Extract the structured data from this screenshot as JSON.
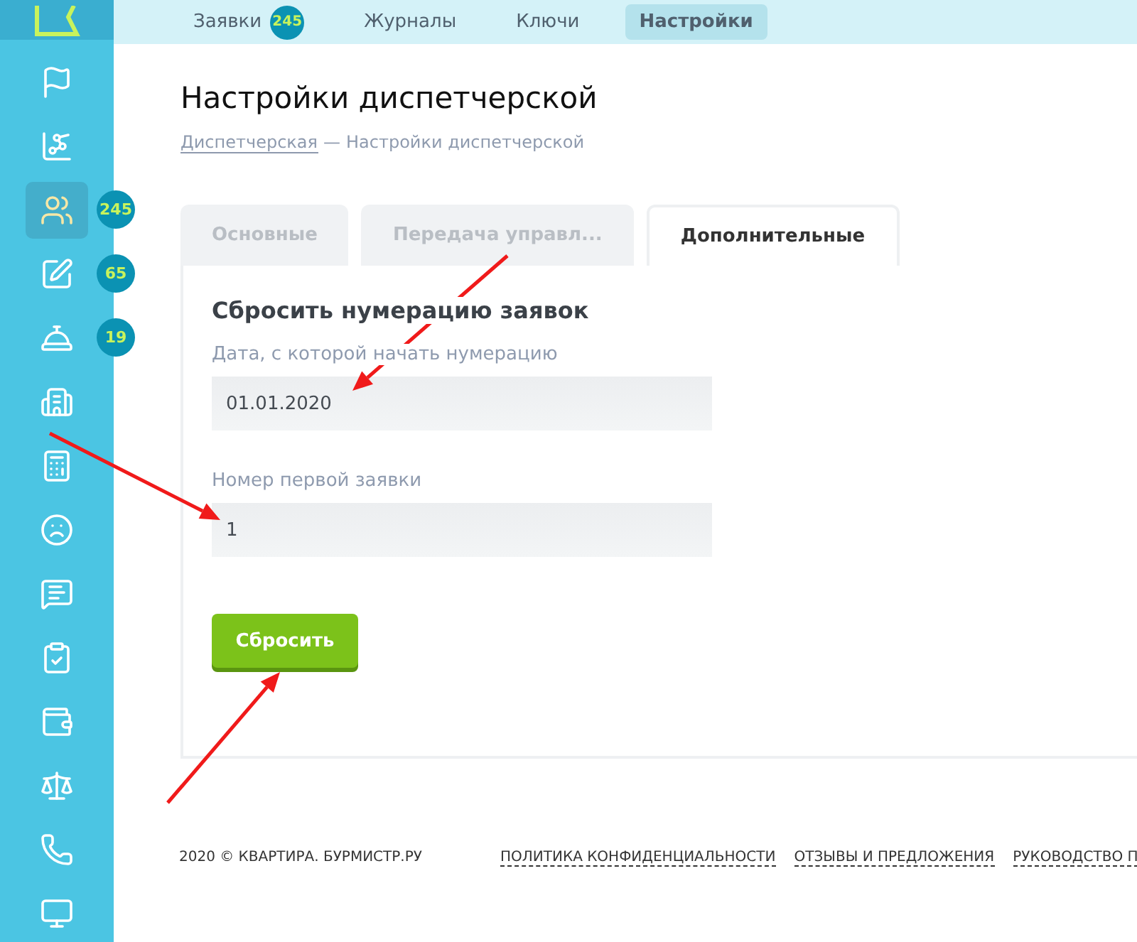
{
  "top_nav": [
    {
      "label": "Заявки",
      "badge": "245",
      "selected": false
    },
    {
      "label": "Журналы",
      "selected": false
    },
    {
      "label": "Ключи",
      "selected": false
    },
    {
      "label": "Настройки",
      "selected": true
    }
  ],
  "sidebar": {
    "items": [
      {
        "selected": false
      },
      {
        "selected": false
      },
      {
        "selected": true,
        "badge": "245"
      },
      {
        "selected": false,
        "badge": "65"
      },
      {
        "selected": false,
        "badge": "19"
      },
      {
        "selected": false
      },
      {
        "selected": false
      },
      {
        "selected": false
      },
      {
        "selected": false
      },
      {
        "selected": false
      },
      {
        "selected": false
      },
      {
        "selected": false
      },
      {
        "selected": false
      },
      {
        "selected": false
      }
    ]
  },
  "page_title": "Настройки диспетчерской",
  "breadcrumb": {
    "link": "Диспетчерская",
    "separator": "—",
    "current": "Настройки диспетчерской"
  },
  "tabs": [
    {
      "label": "Основные",
      "selected": false
    },
    {
      "label": "Передача управл...",
      "selected": false
    },
    {
      "label": "Дополнительные",
      "selected": true
    }
  ],
  "section": {
    "title": "Сбросить нумерацию заявок",
    "fields": [
      {
        "label": "Дата, с которой начать нумерацию",
        "value": "01.01.2020"
      },
      {
        "label": "Номер первой заявки",
        "value": "1"
      }
    ],
    "button": "Сбросить"
  },
  "footer": {
    "copyright": "2020 © КВАРТИРА. БУРМИСТР.РУ",
    "links": [
      "ПОЛИТИКА КОНФИДЕНЦИАЛЬНОСТИ",
      "ОТЗЫВЫ И ПРЕДЛОЖЕНИЯ",
      "РУКОВОДСТВО П"
    ]
  }
}
